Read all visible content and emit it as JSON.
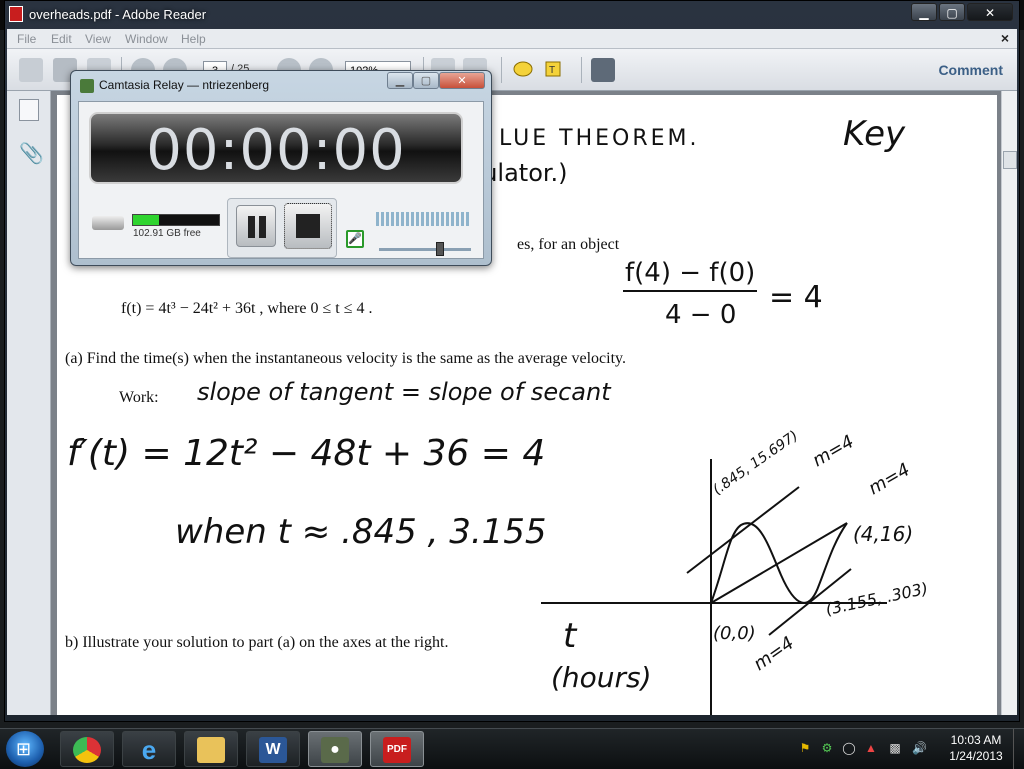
{
  "window": {
    "title": "overheads.pdf - Adobe Reader"
  },
  "menu": {
    "items": [
      "File",
      "Edit",
      "View",
      "Window",
      "Help"
    ],
    "close": "×"
  },
  "toolbar": {
    "page_current": "3",
    "page_total": "/ 25",
    "zoom": "102%",
    "comment_label": "Comment"
  },
  "camtasia": {
    "title": "Camtasia Relay — ntriezenberg",
    "timer": "00:00:00",
    "disk_free": "102.91 GB free",
    "disk_free_fraction": 0.3,
    "volume_fraction": 0.65
  },
  "document": {
    "heading_fragment": "LUE   THEOREM.",
    "calc_fragment": "culator.)",
    "key": "Key",
    "intro_fragment": "es, for an object",
    "equation": "f(t) = 4t³ − 24t² + 36t , where 0 ≤ t ≤ 4 .",
    "avg_num": "f(4) − f(0)",
    "avg_den": "4 − 0",
    "avg_result": "= 4",
    "part_a": "(a)  Find the time(s) when the instantaneous velocity is the same as the average velocity.",
    "work_label": "Work:",
    "work_note": "slope of tangent  =  slope of secant",
    "derivative": "f′(t) = 12t² − 48t + 36  =  4",
    "solution": "when  t ≈ .845 ,  3.155",
    "part_b": "b)  Illustrate your solution to part (a) on the axes at the right.",
    "axis_label_t": "t",
    "axis_label_hours": "(hours)",
    "graph_labels": {
      "p1": "(.845, 15.697)",
      "m1": "m=4",
      "m2": "m=4",
      "p2": "(4,16)",
      "p3": "(3.155, .303)",
      "origin": "(0,0)",
      "m3": "m=4"
    }
  },
  "taskbar": {
    "apps": [
      "chrome",
      "internet-explorer",
      "file-explorer",
      "word",
      "camtasia",
      "adobe-reader"
    ],
    "time": "10:03 AM",
    "date": "1/24/2013"
  }
}
